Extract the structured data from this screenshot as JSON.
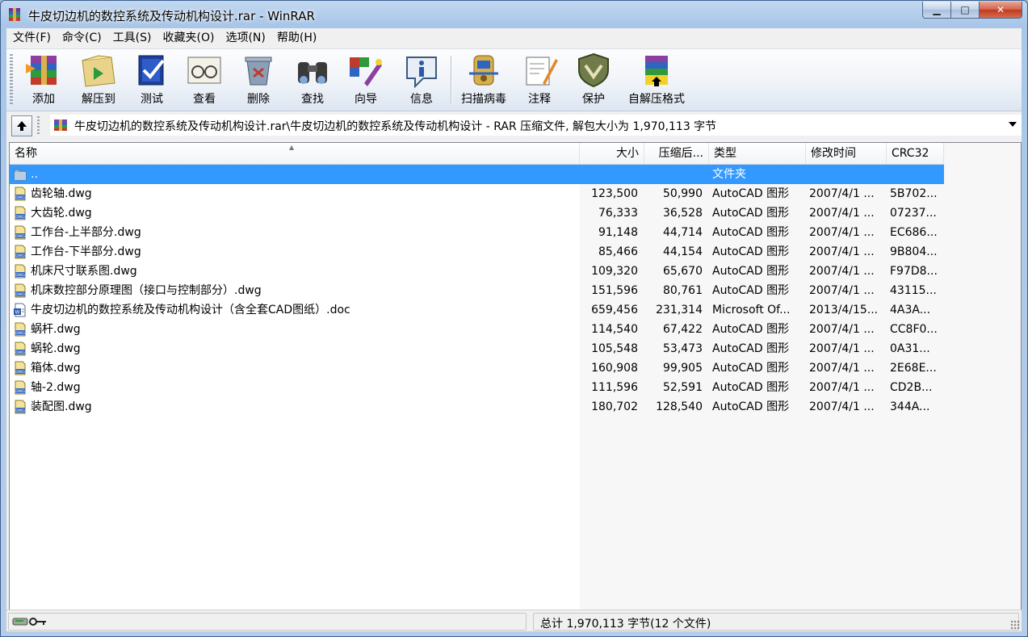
{
  "window": {
    "title": "牛皮切边机的数控系统及传动机构设计.rar - WinRAR",
    "min_glyph": "▁",
    "max_glyph": "□",
    "close_glyph": "✕"
  },
  "menu": [
    "文件(F)",
    "命令(C)",
    "工具(S)",
    "收藏夹(O)",
    "选项(N)",
    "帮助(H)"
  ],
  "toolbar": [
    {
      "label": "添加",
      "icon": "add-archive-icon"
    },
    {
      "label": "解压到",
      "icon": "extract-to-icon"
    },
    {
      "label": "测试",
      "icon": "test-icon"
    },
    {
      "label": "查看",
      "icon": "view-icon"
    },
    {
      "label": "删除",
      "icon": "delete-icon"
    },
    {
      "label": "查找",
      "icon": "find-icon"
    },
    {
      "label": "向导",
      "icon": "wizard-icon"
    },
    {
      "label": "信息",
      "icon": "info-icon"
    },
    {
      "label": "扫描病毒",
      "icon": "virus-scan-icon"
    },
    {
      "label": "注释",
      "icon": "comment-icon"
    },
    {
      "label": "保护",
      "icon": "protect-icon"
    },
    {
      "label": "自解压格式",
      "icon": "sfx-icon"
    }
  ],
  "pathbar": {
    "path": "牛皮切边机的数控系统及传动机构设计.rar\\牛皮切边机的数控系统及传动机构设计 - RAR 压缩文件, 解包大小为 1,970,113 字节"
  },
  "columns": {
    "name": "名称",
    "size": "大小",
    "packed": "压缩后...",
    "type": "类型",
    "modified": "修改时间",
    "crc": "CRC32"
  },
  "parent_row": {
    "name": "..",
    "type": "文件夹"
  },
  "files": [
    {
      "name": "齿轮轴.dwg",
      "size": "123,500",
      "packed": "50,990",
      "type": "AutoCAD 图形",
      "modified": "2007/4/1 ...",
      "crc": "5B702...",
      "kind": "dwg"
    },
    {
      "name": "大齿轮.dwg",
      "size": "76,333",
      "packed": "36,528",
      "type": "AutoCAD 图形",
      "modified": "2007/4/1 ...",
      "crc": "07237...",
      "kind": "dwg"
    },
    {
      "name": "工作台-上半部分.dwg",
      "size": "91,148",
      "packed": "44,714",
      "type": "AutoCAD 图形",
      "modified": "2007/4/1 ...",
      "crc": "EC686...",
      "kind": "dwg"
    },
    {
      "name": "工作台-下半部分.dwg",
      "size": "85,466",
      "packed": "44,154",
      "type": "AutoCAD 图形",
      "modified": "2007/4/1 ...",
      "crc": "9B804...",
      "kind": "dwg"
    },
    {
      "name": "机床尺寸联系图.dwg",
      "size": "109,320",
      "packed": "65,670",
      "type": "AutoCAD 图形",
      "modified": "2007/4/1 ...",
      "crc": "F97D8...",
      "kind": "dwg"
    },
    {
      "name": "机床数控部分原理图（接口与控制部分）.dwg",
      "size": "151,596",
      "packed": "80,761",
      "type": "AutoCAD 图形",
      "modified": "2007/4/1 ...",
      "crc": "43115...",
      "kind": "dwg"
    },
    {
      "name": "牛皮切边机的数控系统及传动机构设计（含全套CAD图纸）.doc",
      "size": "659,456",
      "packed": "231,314",
      "type": "Microsoft Of...",
      "modified": "2013/4/15...",
      "crc": "4A3A...",
      "kind": "doc"
    },
    {
      "name": "蜗杆.dwg",
      "size": "114,540",
      "packed": "67,422",
      "type": "AutoCAD 图形",
      "modified": "2007/4/1 ...",
      "crc": "CC8F0...",
      "kind": "dwg"
    },
    {
      "name": "蜗轮.dwg",
      "size": "105,548",
      "packed": "53,473",
      "type": "AutoCAD 图形",
      "modified": "2007/4/1 ...",
      "crc": "0A31...",
      "kind": "dwg"
    },
    {
      "name": "箱体.dwg",
      "size": "160,908",
      "packed": "99,905",
      "type": "AutoCAD 图形",
      "modified": "2007/4/1 ...",
      "crc": "2E68E...",
      "kind": "dwg"
    },
    {
      "name": "轴-2.dwg",
      "size": "111,596",
      "packed": "52,591",
      "type": "AutoCAD 图形",
      "modified": "2007/4/1 ...",
      "crc": "CD2B...",
      "kind": "dwg"
    },
    {
      "name": "装配图.dwg",
      "size": "180,702",
      "packed": "128,540",
      "type": "AutoCAD 图形",
      "modified": "2007/4/1 ...",
      "crc": "344A...",
      "kind": "dwg"
    }
  ],
  "status": {
    "summary": "总计 1,970,113 字节(12 个文件)"
  },
  "colors": {
    "selection": "#3399ff",
    "titlebar": "#b6cde9"
  }
}
